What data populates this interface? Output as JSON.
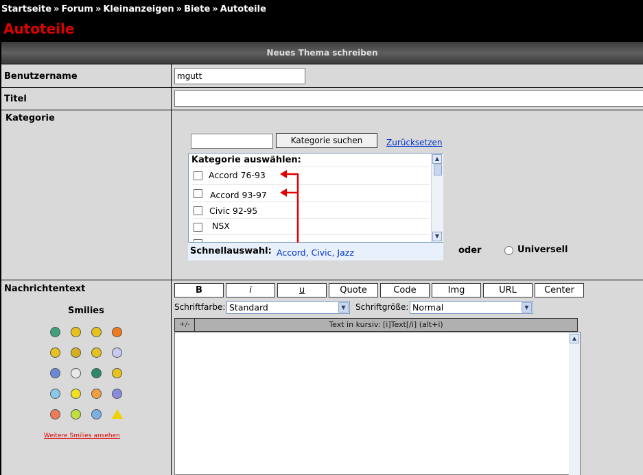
{
  "breadcrumb": {
    "items": [
      "Startseite",
      "Forum",
      "Kleinanzeigen",
      "Biete",
      "Autoteile"
    ],
    "separator": "»"
  },
  "page_title": "Autoteile",
  "form_header": "Neues Thema schreiben",
  "rows": {
    "username_label": "Benutzername",
    "title_label": "Titel",
    "category_label": "Kategorie",
    "message_label": "Nachrichtentext"
  },
  "username_value": "mgutt",
  "title_value": "",
  "category": {
    "search_value": "",
    "search_button": "Kategorie suchen",
    "reset_link": "Zurücksetzen",
    "list_heading": "Kategorie auswählen:",
    "items": [
      "Accord 76-93",
      "Accord 93-97",
      "Civic 92-95",
      "NSX"
    ],
    "quick_label": "Schnellauswahl:",
    "quick_links": "Accord, Civic, Jazz",
    "oder": "oder",
    "universal": "Universell",
    "arrow_color": "#e00000"
  },
  "toolbar": {
    "buttons": [
      "B",
      "i",
      "u",
      "Quote",
      "Code",
      "Img",
      "URL",
      "Center"
    ]
  },
  "font_color": {
    "label": "Schriftfarbe:",
    "value": "Standard"
  },
  "font_size": {
    "label": "Schriftgröße:",
    "value": "Normal"
  },
  "editor": {
    "toggle": "+/-",
    "hint": "Text in kursiv: [i]Text[/i] (alt+i)",
    "content": ""
  },
  "smilies": {
    "title": "Smilies",
    "icons": [
      "grin-smiley-icon",
      "smile-smiley-icon",
      "wink-smiley-icon",
      "angry-smiley-icon",
      "happy-smiley-icon",
      "sad-smiley-icon",
      "tongue-smiley-icon",
      "shocked-smiley-icon",
      "blue-smiley-icon",
      "skull-icon",
      "alien-smiley-icon",
      "dizzy-smiley-icon",
      "confused-smiley-icon",
      "pacman-smiley-icon",
      "cool-smiley-icon",
      "frown-smiley-icon",
      "jumping-smiley-icon",
      "nerd-smiley-icon",
      "nervous-smiley-icon",
      "warning-icon"
    ],
    "more_link": "Weitere Smilies ansehen"
  },
  "colors": {
    "title_red": "#e00000",
    "link_blue": "#0033cc",
    "panel_gray": "#d9d9d9"
  }
}
